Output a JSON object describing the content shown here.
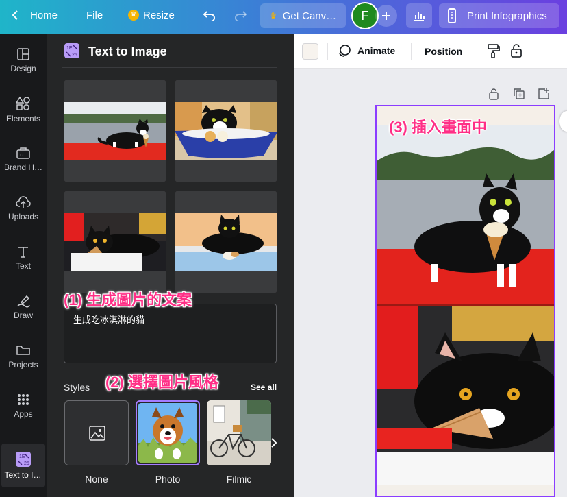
{
  "topbar": {
    "home_label": "Home",
    "file_label": "File",
    "resize_label": "Resize",
    "get_canva_label": "Get Canv…",
    "avatar_letter": "F",
    "print_label": "Print Infographics"
  },
  "rail": {
    "items": [
      {
        "label": "Design",
        "icon": "design-icon"
      },
      {
        "label": "Elements",
        "icon": "elements-icon"
      },
      {
        "label": "Brand H…",
        "icon": "brand-icon"
      },
      {
        "label": "Uploads",
        "icon": "upload-icon"
      },
      {
        "label": "Text",
        "icon": "text-icon"
      },
      {
        "label": "Draw",
        "icon": "draw-icon"
      },
      {
        "label": "Projects",
        "icon": "folder-icon"
      },
      {
        "label": "Apps",
        "icon": "apps-grid-icon"
      },
      {
        "label": "Text to I…",
        "icon": "text-to-image-icon"
      }
    ]
  },
  "panel": {
    "title": "Text to Image",
    "prompt_text": "生成吃冰淇淋的貓",
    "styles_label": "Styles",
    "see_all_label": "See all",
    "styles": [
      {
        "name": "None"
      },
      {
        "name": "Photo"
      },
      {
        "name": "Filmic"
      }
    ]
  },
  "annotations": {
    "step1": "(1) 生成圖片的文案",
    "step2": "(2) 選擇圖片風格",
    "step3": "(3) 插入畫面中"
  },
  "editor_toolbar": {
    "animate_label": "Animate",
    "position_label": "Position"
  },
  "colors": {
    "accent": "#8b3dff",
    "annotation": "#ff2e86",
    "avatar": "#1f8a1f"
  }
}
